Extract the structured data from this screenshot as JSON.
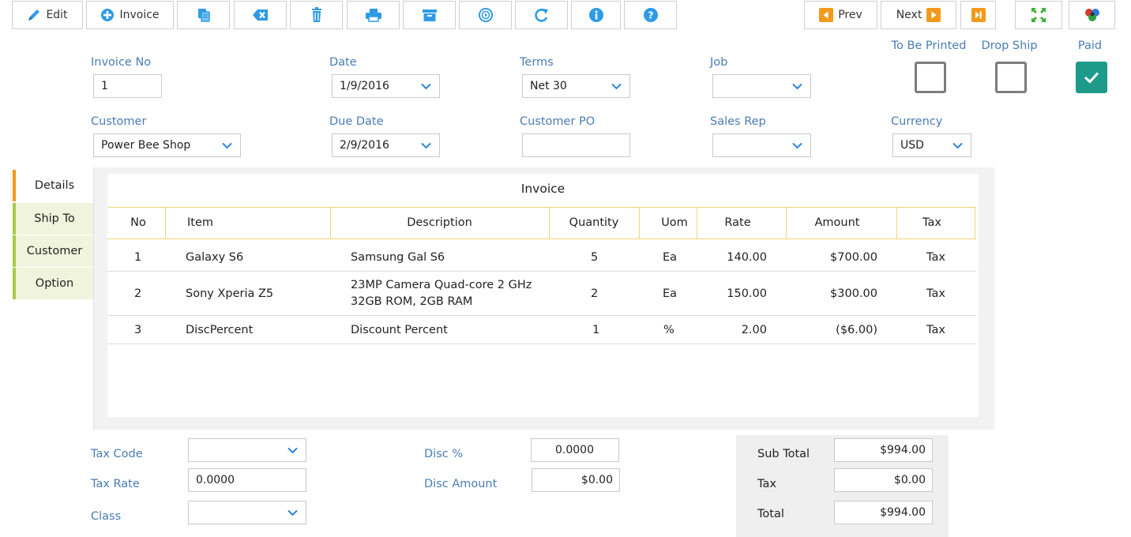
{
  "toolbar": {
    "edit_label": "Edit",
    "invoice_label": "Invoice",
    "prev_label": "Prev",
    "next_label": "Next",
    "icons": [
      "pencil-icon",
      "add-circle-icon",
      "copy-icon",
      "clear-icon",
      "trash-icon",
      "print-icon",
      "archive-icon",
      "clock-refresh-icon",
      "redo-icon",
      "info-icon",
      "help-icon",
      "prev-icon",
      "next-icon",
      "last-icon",
      "fullscreen-icon",
      "color-circles-icon"
    ]
  },
  "header": {
    "invoice_no": {
      "label": "Invoice No",
      "value": "1"
    },
    "date": {
      "label": "Date",
      "value": "1/9/2016"
    },
    "terms": {
      "label": "Terms",
      "value": "Net 30"
    },
    "job": {
      "label": "Job",
      "value": ""
    },
    "customer": {
      "label": "Customer",
      "value": "Power Bee Shop"
    },
    "due_date": {
      "label": "Due Date",
      "value": "2/9/2016"
    },
    "customer_po": {
      "label": "Customer PO",
      "value": ""
    },
    "sales_rep": {
      "label": "Sales Rep",
      "value": ""
    },
    "currency": {
      "label": "Currency",
      "value": "USD"
    },
    "to_be_printed": {
      "label": "To Be Printed",
      "checked": false
    },
    "drop_ship": {
      "label": "Drop Ship",
      "checked": false
    },
    "paid": {
      "label": "Paid",
      "checked": true
    }
  },
  "side_tabs": [
    {
      "label": "Details",
      "active": true
    },
    {
      "label": "Ship To",
      "active": false
    },
    {
      "label": "Customer",
      "active": false
    },
    {
      "label": "Option",
      "active": false
    }
  ],
  "grid": {
    "title": "Invoice",
    "columns": [
      "No",
      "Item",
      "Description",
      "Quantity",
      "Uom",
      "Rate",
      "Amount",
      "Tax"
    ],
    "rows": [
      {
        "no": "1",
        "item": "Galaxy S6",
        "description": [
          "Samsung Gal S6"
        ],
        "quantity": "5",
        "uom": "Ea",
        "rate": "140.00",
        "amount": "$700.00",
        "tax": "Tax"
      },
      {
        "no": "2",
        "item": "Sony Xperia Z5",
        "description": [
          "23MP Camera Quad-core 2 GHz",
          "32GB ROM, 2GB RAM"
        ],
        "quantity": "2",
        "uom": "Ea",
        "rate": "150.00",
        "amount": "$300.00",
        "tax": "Tax"
      },
      {
        "no": "3",
        "item": "DiscPercent",
        "description": [
          "Discount Percent"
        ],
        "quantity": "1",
        "uom": "%",
        "rate": "2.00",
        "amount": "($6.00)",
        "tax": "Tax"
      }
    ]
  },
  "footer": {
    "tax_code": {
      "label": "Tax Code",
      "value": ""
    },
    "tax_rate": {
      "label": "Tax Rate",
      "value": "0.0000"
    },
    "class": {
      "label": "Class",
      "value": ""
    },
    "disc_pct": {
      "label": "Disc %",
      "value": "0.0000"
    },
    "disc_amount": {
      "label": "Disc Amount",
      "value": "$0.00"
    },
    "sub_total": {
      "label": "Sub Total",
      "value": "$994.00"
    },
    "tax": {
      "label": "Tax",
      "value": "$0.00"
    },
    "total": {
      "label": "Total",
      "value": "$994.00"
    }
  },
  "colors": {
    "label_blue": "#4a7cb4",
    "icon_blue": "#2f9be6",
    "accent_orange": "#f29a1b",
    "paid_teal": "#1d9a8a",
    "tab_green": "#a9c84a",
    "header_line": "#f0d57a"
  }
}
